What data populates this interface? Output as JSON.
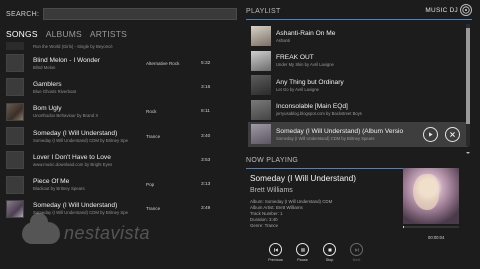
{
  "search": {
    "label": "SEARCH:",
    "value": "",
    "placeholder": ""
  },
  "tabs": [
    "SONGS",
    "ALBUMS",
    "ARTISTS"
  ],
  "songs": [
    {
      "title": "",
      "sub": "Run the World (Girls) - Single by Beyoncé",
      "genre": "",
      "duration": ""
    },
    {
      "title": "Blind Melon - I Wonder",
      "sub": "Blind Melon",
      "genre": "Alternative Rock",
      "duration": "5:32"
    },
    {
      "title": "Gamblers",
      "sub": "Blue Ghosts Riverboat",
      "genre": "",
      "duration": "3:16"
    },
    {
      "title": "Bom Ugly",
      "sub": "Unorthodox Behaviour by Brand X",
      "genre": "Rock",
      "duration": "8:11"
    },
    {
      "title": "Someday (I Will Understand)",
      "sub": "Someday (I Will Understand) CDM by Britney Spe",
      "genre": "Trance",
      "duration": "3:40"
    },
    {
      "title": "Lover I Don't Have to Love",
      "sub": "www.music.download.com by Bright Eyes",
      "genre": "",
      "duration": "3:53"
    },
    {
      "title": "Piece Of Me",
      "sub": "Blackout by Britney Spears",
      "genre": "Pop",
      "duration": "3:13"
    },
    {
      "title": "Someday (I Will Understand)",
      "sub": "Someday (I Will Understand) CDM by Britney Spe",
      "genre": "Trance",
      "duration": "3:49"
    }
  ],
  "watermark": "nestavista",
  "app": {
    "title": "MUSIC DJ",
    "icon": "music-disc-icon"
  },
  "playlist": {
    "header": "PLAYLIST",
    "items": [
      {
        "title": "Ashanti-Rain On Me",
        "sub": "Ashanti"
      },
      {
        "title": "FREAK OUT",
        "sub": "Under My Skin by Avril Lavigne"
      },
      {
        "title": "Any Thing but Ordinary",
        "sub": "Let Go by Avril Lavigne"
      },
      {
        "title": "Inconsolable [Main EQd]",
        "sub": "jorryusablog.blogspot.com by Backstreet Boys"
      },
      {
        "title": "Someday (I Will Understand)  (Album  Versio",
        "sub": "Someday (I Will Understand) CDM by Britney Spears"
      }
    ]
  },
  "now_playing": {
    "header": "NOW PLAYING",
    "title": "Someday (I Will Understand)",
    "artist": "Brett Williams",
    "album": "Album: Someday (I Will Understand) CDM",
    "album_artist": "Album Artist: Brett Williams",
    "track": "Track Number: 1",
    "duration": "Duration: 3:40",
    "genre": "Genre: Trance",
    "time": "00:00:04",
    "progress": 0.02
  },
  "controls": {
    "previous": "Previous",
    "pause": "Pause",
    "stop": "Stop",
    "next": "Next"
  }
}
